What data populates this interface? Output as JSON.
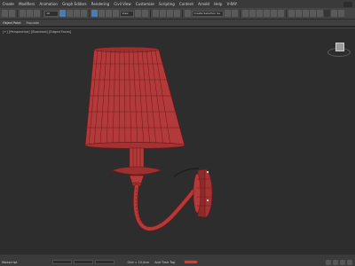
{
  "menubar": {
    "items": [
      "Create",
      "Modifiers",
      "Animation",
      "Graph Editors",
      "Rendering",
      "Civil View",
      "Customize",
      "Scripting",
      "Content",
      "Arnold",
      "Help",
      "V-RAY"
    ]
  },
  "toolbar": {
    "view_select": "View",
    "named_selection": "Create Selection Se"
  },
  "ribbon": {
    "tabs": [
      "Object Paint",
      "Populate"
    ]
  },
  "viewport": {
    "label": "[+] [Perspective] [Standard] [Edged Faces]",
    "model_color": "#b23a3a",
    "wire_color": "#6e1818"
  },
  "statusbar": {
    "left_text": "Maxscript",
    "grid_readout": "Grid = 10,0cm",
    "time_tag": "Add Time Tag"
  }
}
